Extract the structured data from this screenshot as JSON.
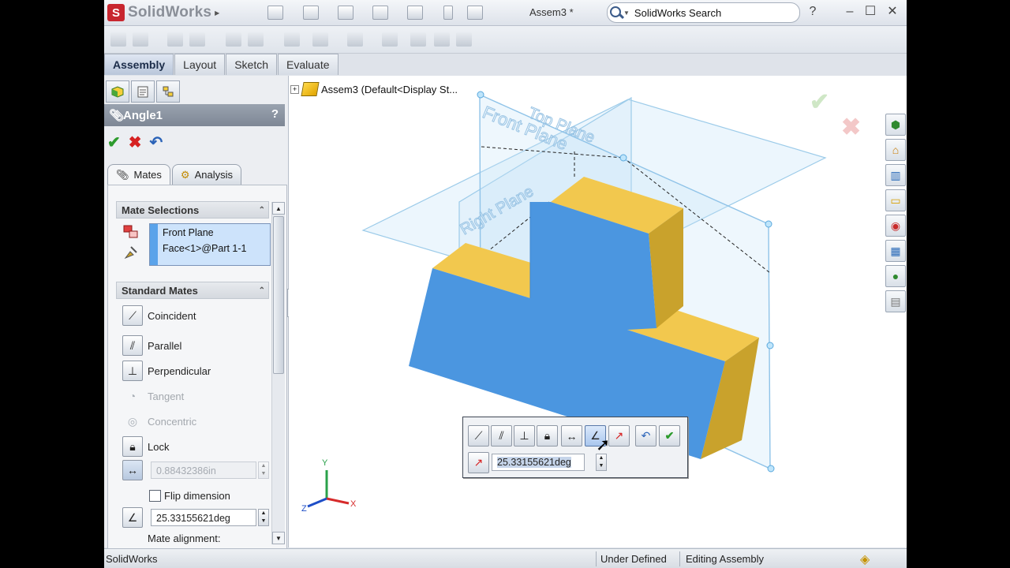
{
  "app": {
    "name": "SolidWorks",
    "document_title": "Assem3 *",
    "search_placeholder": "SolidWorks Search",
    "help": "?",
    "win_controls": [
      "–",
      "☐",
      "✕"
    ]
  },
  "command_tabs": [
    {
      "label": "Assembly",
      "active": true
    },
    {
      "label": "Layout",
      "active": false
    },
    {
      "label": "Sketch",
      "active": false
    },
    {
      "label": "Evaluate",
      "active": false
    }
  ],
  "property_manager": {
    "title": "Angle1",
    "help": "?",
    "subtabs": [
      {
        "label": "Mates",
        "active": true
      },
      {
        "label": "Analysis",
        "active": false
      }
    ],
    "mate_selections": {
      "title": "Mate Selections",
      "items": [
        "Front Plane",
        "Face<1>@Part 1-1"
      ]
    },
    "standard_mates": {
      "title": "Standard Mates",
      "items": [
        {
          "label": "Coincident",
          "enabled": true,
          "icon": "coincident-icon"
        },
        {
          "label": "Parallel",
          "enabled": true,
          "icon": "parallel-icon"
        },
        {
          "label": "Perpendicular",
          "enabled": true,
          "icon": "perpendicular-icon"
        },
        {
          "label": "Tangent",
          "enabled": false,
          "icon": "tangent-icon"
        },
        {
          "label": "Concentric",
          "enabled": false,
          "icon": "concentric-icon"
        },
        {
          "label": "Lock",
          "enabled": true,
          "icon": "lock-icon"
        }
      ],
      "distance_value": "0.88432386in",
      "flip_label": "Flip dimension",
      "flip_checked": false,
      "angle_value": "25.33155621deg",
      "alignment_label": "Mate alignment:"
    }
  },
  "feature_tree": {
    "root_label": "Assem3  (Default<Display St..."
  },
  "planes": {
    "front": "Front Plane",
    "top": "Top Plane",
    "right": "Right Plane"
  },
  "popup_toolbar": {
    "angle_value": "25.33155621deg"
  },
  "triad": {
    "x": "X",
    "y": "Y",
    "z": "Z"
  },
  "status_bar": {
    "left": "SolidWorks",
    "state": "Under Defined",
    "mode": "Editing Assembly"
  },
  "colors": {
    "part_front": "#4b96e0",
    "part_top": "#f2c84e",
    "part_side": "#c9a22c",
    "plane_edge": "#8fc3e8",
    "accept": "#2d9b2d",
    "cancel": "#d62121"
  }
}
